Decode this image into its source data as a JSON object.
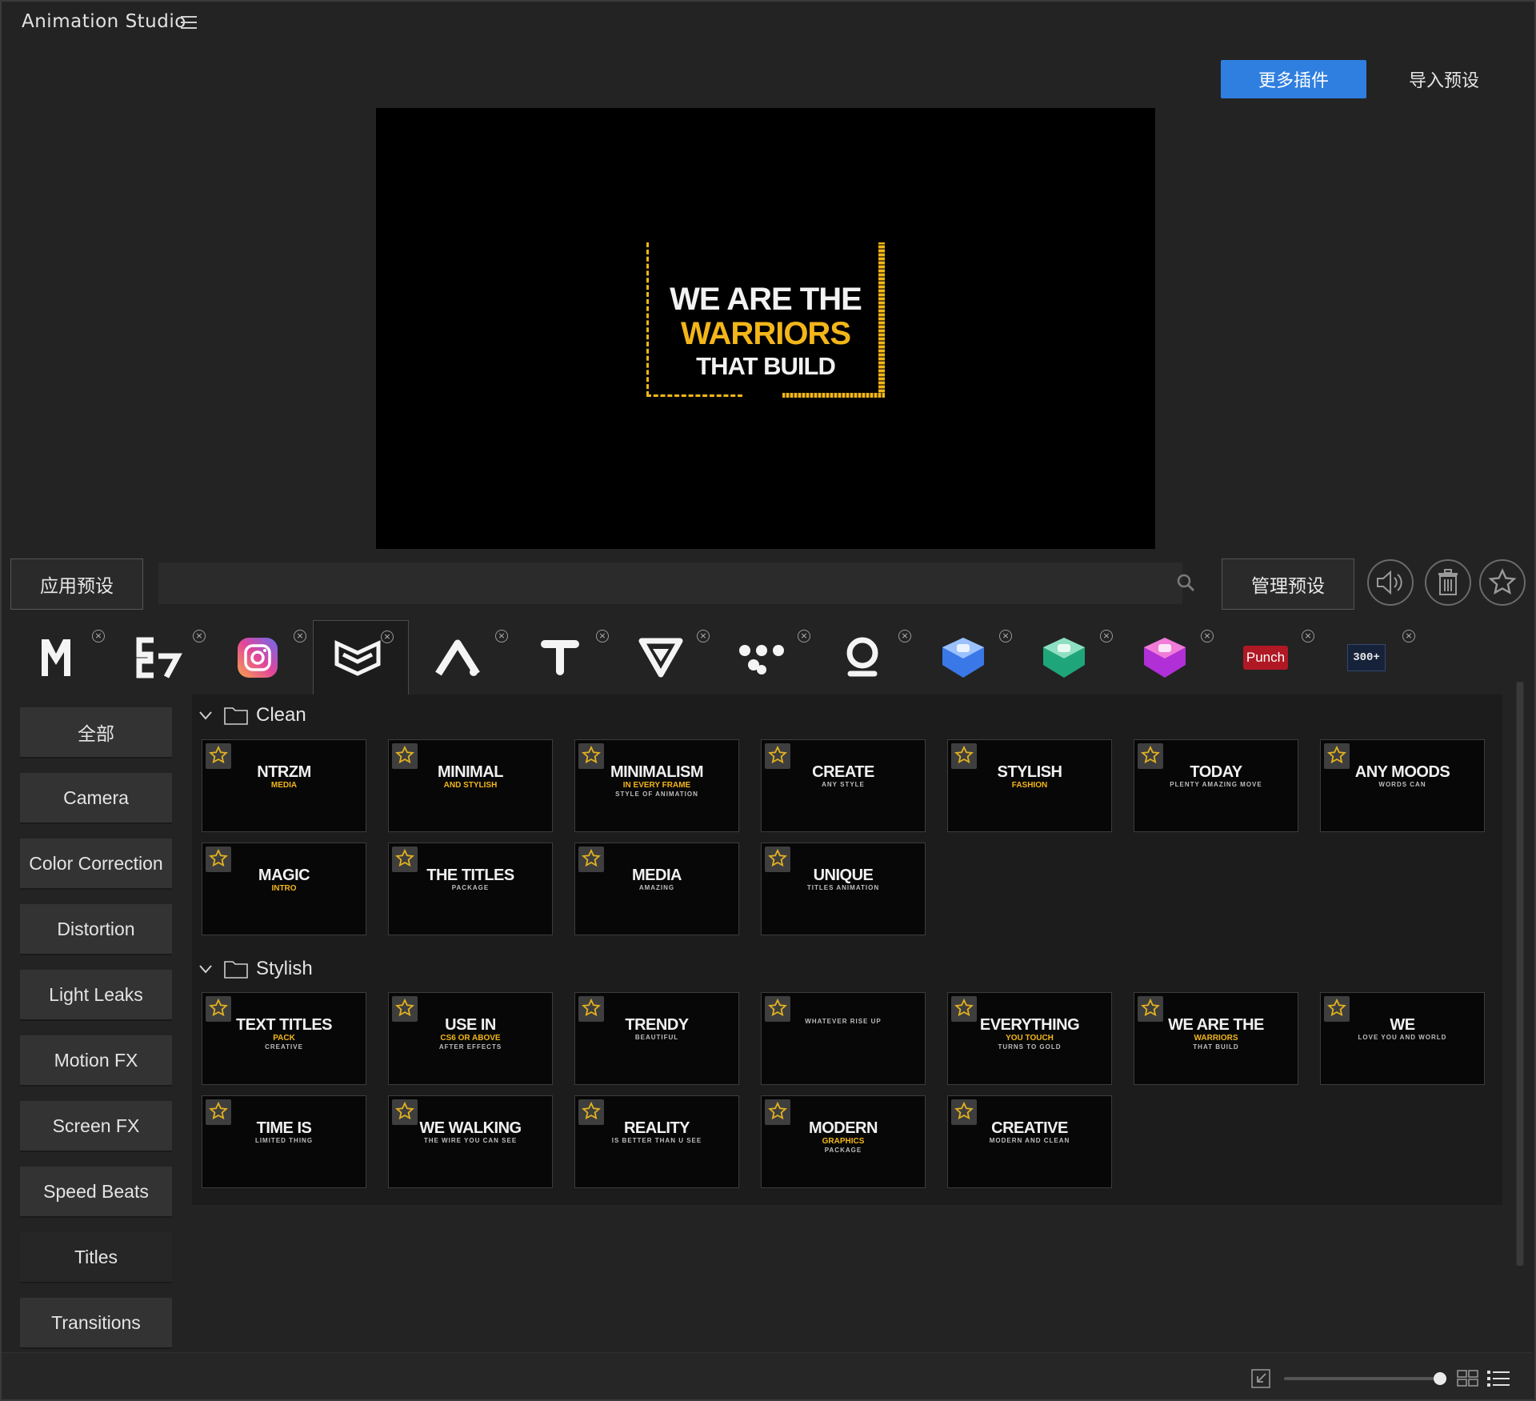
{
  "app": {
    "title": "Animation Studio"
  },
  "header": {
    "more_plugins": "更多插件",
    "import_preset": "导入预设"
  },
  "preview": {
    "line1": "WE ARE THE",
    "line2": "WARRIORS",
    "line3": "THAT BUILD"
  },
  "controls": {
    "apply_preset": "应用预设",
    "search_value": "",
    "manage_preset": "管理预设"
  },
  "plugins": [
    {
      "name": "m-logo-icon"
    },
    {
      "name": "e7-logo-icon"
    },
    {
      "name": "camera-app-icon"
    },
    {
      "name": "chevron-badge-icon"
    },
    {
      "name": "a-logo-icon"
    },
    {
      "name": "t-logo-icon"
    },
    {
      "name": "v-logo-icon"
    },
    {
      "name": "dots-logo-icon"
    },
    {
      "name": "o-logo-icon"
    },
    {
      "name": "blue-cube-icon"
    },
    {
      "name": "green-cube-icon"
    },
    {
      "name": "purple-cube-icon"
    },
    {
      "name": "punch-logo-icon",
      "text": "Punch"
    },
    {
      "name": "300-logo-icon",
      "text": "300+"
    }
  ],
  "categories": [
    "全部",
    "Camera",
    "Color Correction",
    "Distortion",
    "Light Leaks",
    "Motion FX",
    "Screen FX",
    "Speed Beats",
    "Titles",
    "Transitions"
  ],
  "groups": [
    {
      "label": "Clean",
      "tiles": [
        {
          "t1": "NTRZM",
          "t2": "MEDIA",
          "t3": ""
        },
        {
          "t1": "MINIMAL",
          "t2": "AND STYLISH",
          "t3": ""
        },
        {
          "t1": "MINIMALISM",
          "t2": "IN EVERY FRAME",
          "t3": "STYLE OF ANIMATION"
        },
        {
          "t1": "CREATE",
          "t2": "",
          "t3": "ANY STYLE"
        },
        {
          "t1": "STYLISH",
          "t2": "FASHION",
          "t3": ""
        },
        {
          "t1": "TODAY",
          "t2": "",
          "t3": "PLENTY AMAZING MOVE"
        },
        {
          "t1": "ANY MOODS",
          "t2": "",
          "t3": "WORDS CAN"
        },
        {
          "t1": "MAGIC",
          "t2": "INTRO",
          "t3": ""
        },
        {
          "t1": "THE TITLES",
          "t2": "",
          "t3": "PACKAGE"
        },
        {
          "t1": "MEDIA",
          "t2": "",
          "t3": "AMAZING"
        },
        {
          "t1": "UNIQUE",
          "t2": "",
          "t3": "TITLES ANIMATION"
        }
      ]
    },
    {
      "label": "Stylish",
      "tiles": [
        {
          "t1": "TEXT TITLES",
          "t2": "PACK",
          "t3": "CREATIVE"
        },
        {
          "t1": "USE IN",
          "t2": "CS6 OR ABOVE",
          "t3": "AFTER EFFECTS"
        },
        {
          "t1": "TRENDY",
          "t2": "",
          "t3": "BEAUTIFUL"
        },
        {
          "t1": "",
          "t2": "",
          "t3": "WHATEVER RISE UP"
        },
        {
          "t1": "EVERYTHING",
          "t2": "YOU TOUCH",
          "t3": "TURNS TO GOLD"
        },
        {
          "t1": "WE ARE THE",
          "t2": "WARRIORS",
          "t3": "THAT BUILD"
        },
        {
          "t1": "WE",
          "t2": "",
          "t3": "LOVE YOU AND WORLD"
        },
        {
          "t1": "TIME IS",
          "t2": "",
          "t3": "LIMITED THING"
        },
        {
          "t1": "WE WALKING",
          "t2": "",
          "t3": "THE WIRE YOU CAN SEE"
        },
        {
          "t1": "REALITY",
          "t2": "",
          "t3": "IS BETTER THAN U SEE"
        },
        {
          "t1": "MODERN",
          "t2": "GRAPHICS",
          "t3": "PACKAGE"
        },
        {
          "t1": "CREATIVE",
          "t2": "",
          "t3": "MODERN AND CLEAN"
        }
      ]
    }
  ],
  "colors": {
    "accent": "#2f7fe0",
    "gold": "#f2b619",
    "bg": "#232323"
  }
}
